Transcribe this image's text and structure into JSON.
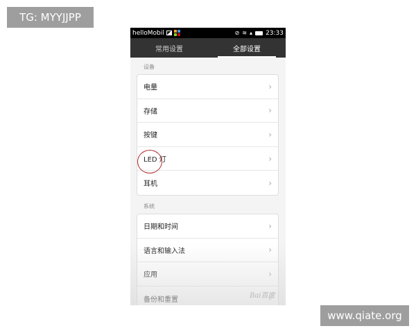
{
  "overlay": {
    "top_tag": "TG: MYYJJPP",
    "bottom_tag": "www.qiate.org"
  },
  "statusbar": {
    "app_name": "helloMobil",
    "time": "23:33",
    "icons": [
      "image-icon",
      "colorful-grid-icon",
      "mute-icon",
      "wifi-icon",
      "signal-icon",
      "battery-icon"
    ]
  },
  "tabs": [
    {
      "label": "常用设置",
      "active": false
    },
    {
      "label": "全部设置",
      "active": true
    }
  ],
  "sections": [
    {
      "title": "设备",
      "items": [
        "电量",
        "存储",
        "按键",
        "LED 灯",
        "耳机"
      ]
    },
    {
      "title": "系统",
      "items": [
        "日期和时间",
        "语言和输入法",
        "应用",
        "备份和重置"
      ]
    }
  ],
  "highlighted_item": "按键",
  "highlight_color": "#b02a2a",
  "watermark": "Bai百度"
}
